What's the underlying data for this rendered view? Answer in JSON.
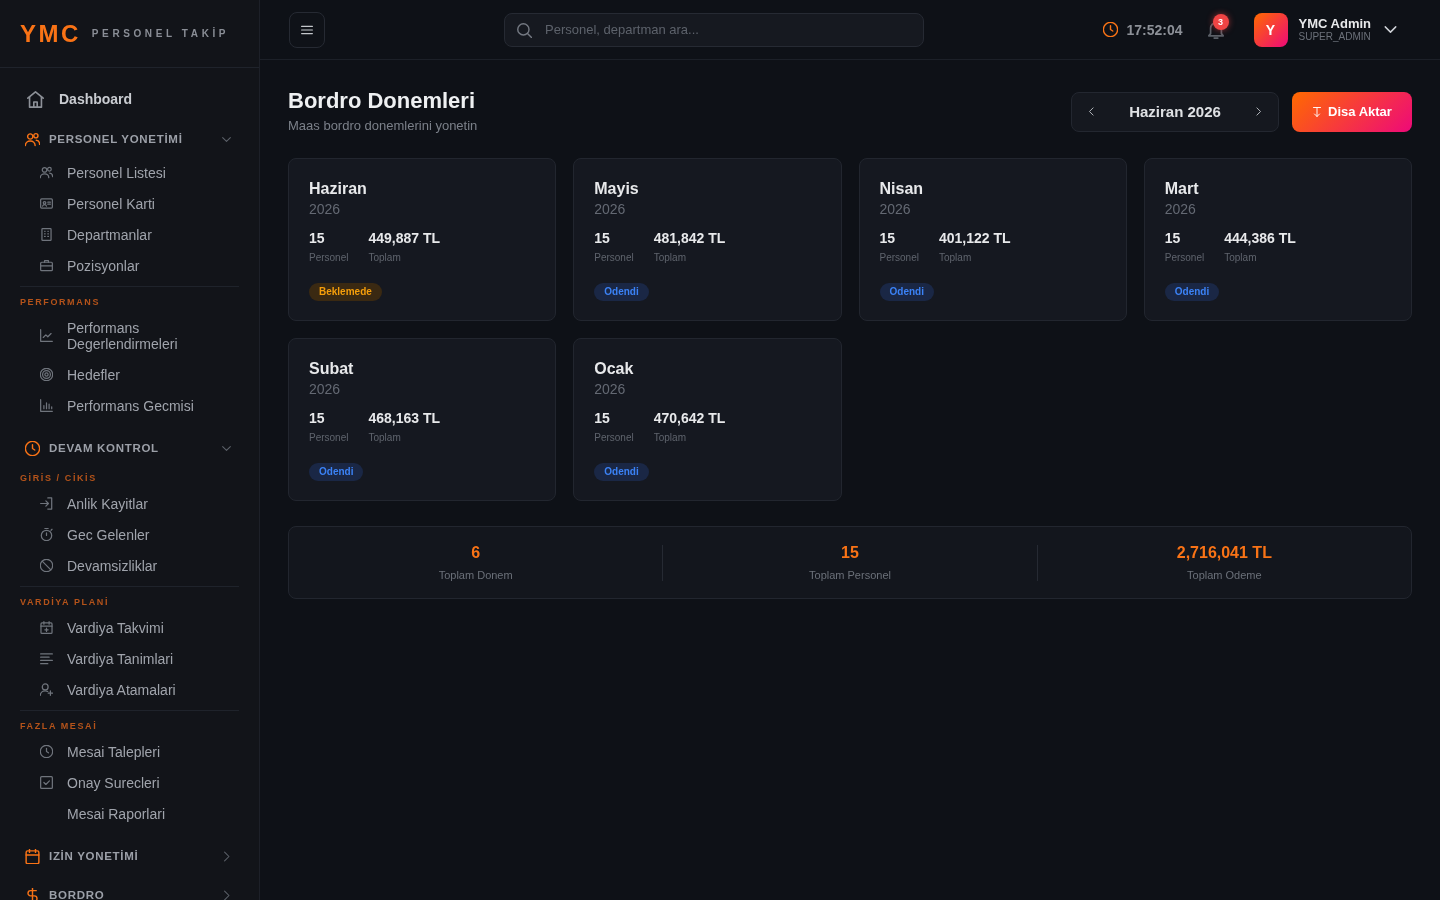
{
  "sidebar": {
    "logo": {
      "mark": "YMC",
      "tagline": "PERSONEL TAKİP"
    },
    "nav": [
      {
        "kind": "link",
        "label": "Dashboard"
      },
      {
        "kind": "section",
        "label": "PERSONEL YONETİMİ",
        "expanded": true,
        "groups": [
          {
            "items": [
              {
                "label": "Personel Listesi"
              },
              {
                "label": "Personel Karti"
              },
              {
                "label": "Departmanlar"
              },
              {
                "label": "Pozisyonlar"
              }
            ]
          },
          {
            "label": "PERFORMANS",
            "items": [
              {
                "label": "Performans Degerlendirmeleri"
              },
              {
                "label": "Hedefler"
              },
              {
                "label": "Performans Gecmisi"
              }
            ]
          }
        ]
      },
      {
        "kind": "section",
        "label": "DEVAM KONTROL",
        "expanded": true,
        "groups": [
          {
            "label": "GİRİS / CİKİS",
            "items": [
              {
                "label": "Anlik Kayitlar"
              },
              {
                "label": "Gec Gelenler"
              },
              {
                "label": "Devamsizliklar"
              }
            ]
          },
          {
            "label": "VARDİYA PLANİ",
            "items": [
              {
                "label": "Vardiya Takvimi"
              },
              {
                "label": "Vardiya Tanimlari"
              },
              {
                "label": "Vardiya Atamalari"
              }
            ]
          },
          {
            "label": "FAZLA MESAİ",
            "items": [
              {
                "label": "Mesai Talepleri"
              },
              {
                "label": "Onay Surecleri"
              },
              {
                "label": "Mesai Raporlari"
              }
            ]
          }
        ]
      },
      {
        "kind": "section",
        "label": "IZİN YONETİMİ",
        "expanded": false
      },
      {
        "kind": "section",
        "label": "BORDRO",
        "expanded": false
      }
    ]
  },
  "topbar": {
    "search": {
      "placeholder": "Personel, departman ara..."
    },
    "time": "17:52:04",
    "notifications": {
      "count": "3"
    },
    "user": {
      "initial": "Y",
      "name": "YMC Admin",
      "role": "SUPER_ADMIN"
    }
  },
  "page": {
    "title": "Bordro Donemleri",
    "subtitle": "Maas bordro donemlerini yonetin",
    "period": {
      "label": "Haziran 2026"
    },
    "export_button": "Disa Aktar"
  },
  "periods": [
    {
      "month": "Haziran",
      "year": "2026",
      "staff_count": "15",
      "staff_label": "Personel",
      "total": "449,887 TL",
      "total_label": "Toplam",
      "kind": "pending",
      "status": "Beklemede"
    },
    {
      "month": "Mayis",
      "year": "2026",
      "staff_count": "15",
      "staff_label": "Personel",
      "total": "481,842 TL",
      "total_label": "Toplam",
      "kind": "paid",
      "status": "Odendi"
    },
    {
      "month": "Nisan",
      "year": "2026",
      "staff_count": "15",
      "staff_label": "Personel",
      "total": "401,122 TL",
      "total_label": "Toplam",
      "kind": "paid",
      "status": "Odendi"
    },
    {
      "month": "Mart",
      "year": "2026",
      "staff_count": "15",
      "staff_label": "Personel",
      "total": "444,386 TL",
      "total_label": "Toplam",
      "kind": "paid",
      "status": "Odendi"
    },
    {
      "month": "Subat",
      "year": "2026",
      "staff_count": "15",
      "staff_label": "Personel",
      "total": "468,163 TL",
      "total_label": "Toplam",
      "kind": "paid",
      "status": "Odendi"
    },
    {
      "month": "Ocak",
      "year": "2026",
      "staff_count": "15",
      "staff_label": "Personel",
      "total": "470,642 TL",
      "total_label": "Toplam",
      "kind": "paid",
      "status": "Odendi"
    }
  ],
  "summary": [
    {
      "value": "6",
      "label": "Toplam Donem"
    },
    {
      "value": "15",
      "label": "Toplam Personel"
    },
    {
      "value": "2,716,041 TL",
      "label": "Toplam Odeme"
    }
  ]
}
